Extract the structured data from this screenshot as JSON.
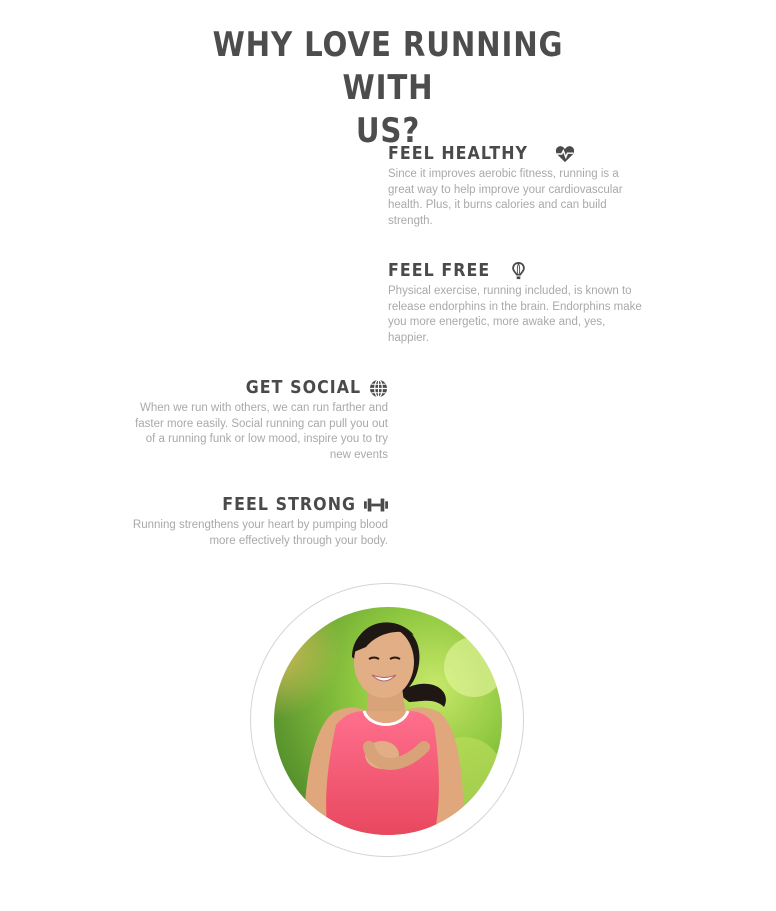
{
  "heading": {
    "line1": "WHY LOVE RUNNING WITH",
    "line2": "US?"
  },
  "features": [
    {
      "title": "FEEL HEALTHY",
      "icon": "heartbeat-icon",
      "text": "Since it improves aerobic fitness, running is a great way to help improve your cardiovascular health. Plus, it burns calories and can build strength."
    },
    {
      "title": "FEEL FREE",
      "icon": "hot-air-balloon-icon",
      "text": "Physical exercise, running included, is known to release endorphins in the brain. Endorphins make you more energetic, more awake and, yes, happier."
    },
    {
      "title": "GET SOCIAL",
      "icon": "globe-icon",
      "text": "When we run with others, we can run farther and faster more easily. Social running can pull you out of a running funk or low mood, inspire you to try new events"
    },
    {
      "title": "FEEL STRONG",
      "icon": "dumbbell-icon",
      "text": "Running strengthens your heart by pumping blood more effectively through your body."
    }
  ],
  "colors": {
    "heading": "#4d4d4d",
    "body_text": "#a9a9a9",
    "ring": "#d4d4d4",
    "shirt": "#f45a78",
    "background_foliage": "#8cc63f"
  }
}
